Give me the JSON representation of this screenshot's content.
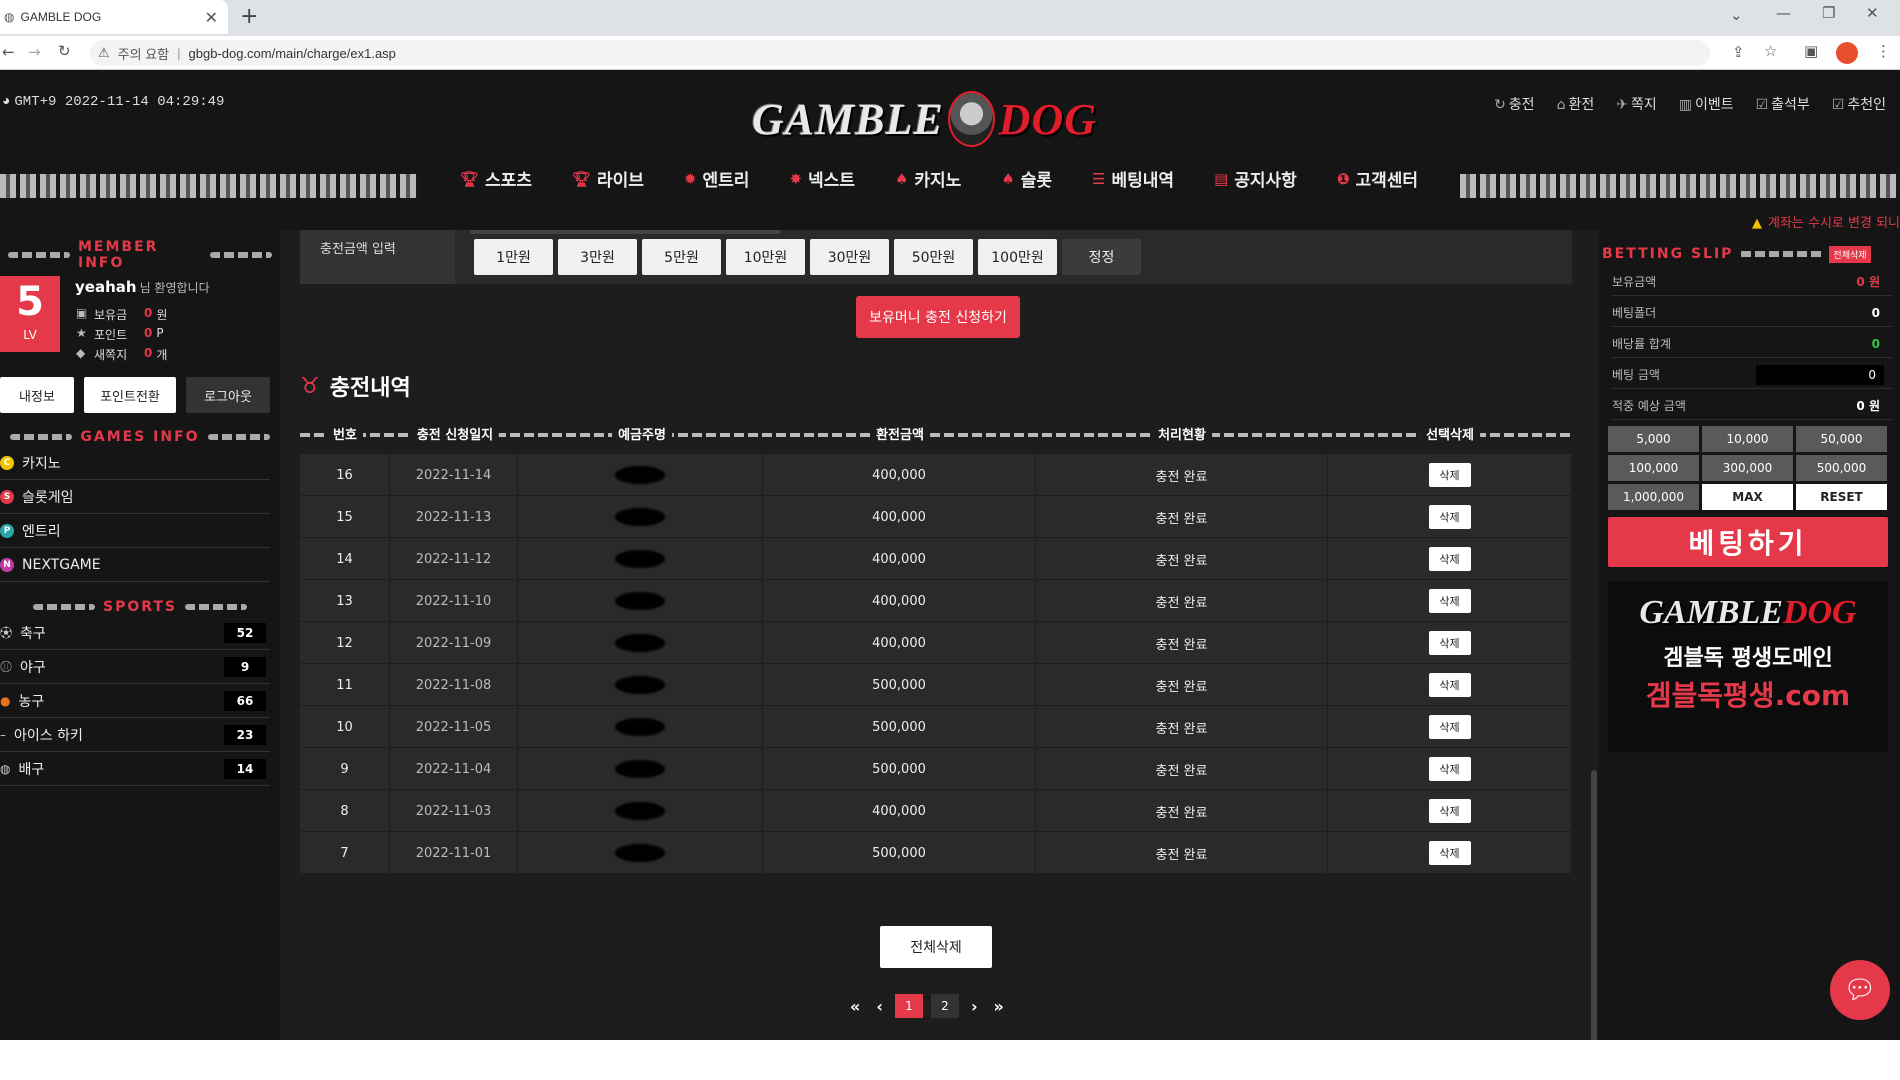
{
  "browser": {
    "tab_title": "GAMBLE DOG",
    "tab_close": "✕",
    "new_tab": "+",
    "security_label": "주의 요함",
    "url": "gbgb-dog.com/main/charge/ex1.asp"
  },
  "header": {
    "clock": "GMT+9 2022-11-14 04:29:49",
    "logo_left": "GAMBLE",
    "logo_right": "DOG",
    "top_links": [
      "충전",
      "환전",
      "쪽지",
      "이벤트",
      "출석부",
      "추천인"
    ],
    "nav": [
      "스포츠",
      "라이브",
      "엔트리",
      "넥스트",
      "카지노",
      "슬롯",
      "베팅내역",
      "공지사항",
      "고객센터"
    ],
    "notice": "계좌는 수시로 변경 되니"
  },
  "left": {
    "member_info_title": "MEMBER INFO",
    "level": "5",
    "level_label": "LV",
    "username": "yeahah",
    "welcome": "님 환영합니다",
    "balance_label": "보유금",
    "balance_value": "0",
    "balance_unit": "원",
    "point_label": "포인트",
    "point_value": "0",
    "point_unit": "P",
    "message_label": "새쪽지",
    "message_value": "0",
    "message_unit": "개",
    "btn_myinfo": "내정보",
    "btn_point": "포인트전환",
    "btn_logout": "로그아웃",
    "games_title": "GAMES INFO",
    "games": [
      {
        "label": "카지노",
        "badge": "C",
        "color": "#f4c400"
      },
      {
        "label": "슬롯게임",
        "badge": "S",
        "color": "#e5394a"
      },
      {
        "label": "엔트리",
        "badge": "P",
        "color": "#2aa6a6"
      },
      {
        "label": "NEXTGAME",
        "badge": "N",
        "color": "#c03aa8"
      }
    ],
    "sports_title": "SPORTS",
    "sports": [
      {
        "label": "축구",
        "count": "52"
      },
      {
        "label": "야구",
        "count": "9"
      },
      {
        "label": "농구",
        "count": "66"
      },
      {
        "label": "아이스 하키",
        "count": "23"
      },
      {
        "label": "배구",
        "count": "14"
      }
    ]
  },
  "main": {
    "amount_label": "충전금액 입력",
    "amount_buttons": [
      "1만원",
      "3만원",
      "5만원",
      "10만원",
      "30만원",
      "50만원",
      "100만원",
      "정정"
    ],
    "request_button": "보유머니 충전 신청하기",
    "history_title": "충전내역",
    "columns": [
      "번호",
      "충전 신청일지",
      "예금주명",
      "환전금액",
      "처리현황",
      "선택삭제"
    ],
    "rows": [
      {
        "no": "16",
        "date": "2022-11-14",
        "amount": "400,000",
        "status": "충전 완료"
      },
      {
        "no": "15",
        "date": "2022-11-13",
        "amount": "400,000",
        "status": "충전 완료"
      },
      {
        "no": "14",
        "date": "2022-11-12",
        "amount": "400,000",
        "status": "충전 완료"
      },
      {
        "no": "13",
        "date": "2022-11-10",
        "amount": "400,000",
        "status": "충전 완료"
      },
      {
        "no": "12",
        "date": "2022-11-09",
        "amount": "400,000",
        "status": "충전 완료"
      },
      {
        "no": "11",
        "date": "2022-11-08",
        "amount": "500,000",
        "status": "충전 완료"
      },
      {
        "no": "10",
        "date": "2022-11-05",
        "amount": "500,000",
        "status": "충전 완료"
      },
      {
        "no": "9",
        "date": "2022-11-04",
        "amount": "500,000",
        "status": "충전 완료"
      },
      {
        "no": "8",
        "date": "2022-11-03",
        "amount": "400,000",
        "status": "충전 완료"
      },
      {
        "no": "7",
        "date": "2022-11-01",
        "amount": "500,000",
        "status": "충전 완료"
      }
    ],
    "delete_label": "삭제",
    "delete_all": "전체삭제",
    "pages": [
      "1",
      "2"
    ],
    "current_page": "1"
  },
  "slip": {
    "title": "BETTING SLIP",
    "clear_all": "전체삭제",
    "rows": [
      {
        "label": "보유금액",
        "value": "0 원",
        "style": "red"
      },
      {
        "label": "베팅폴더",
        "value": "0",
        "style": ""
      },
      {
        "label": "배당률 합계",
        "value": "0",
        "style": "grn"
      },
      {
        "label": "베팅 금액",
        "value": "0",
        "style": "input"
      },
      {
        "label": "적중 예상 금액",
        "value": "0 원",
        "style": ""
      }
    ],
    "chips": [
      "5,000",
      "10,000",
      "50,000",
      "100,000",
      "300,000",
      "500,000",
      "1,000,000",
      "MAX",
      "RESET"
    ],
    "bet_button": "베팅하기",
    "banner_line1": "겜블독 평생도메인",
    "banner_line2": "겜블독평생.com"
  },
  "colors": {
    "accent": "#e5394a",
    "bg": "#1d1d1d",
    "panel": "#151515",
    "row": "#2a2a2a"
  }
}
